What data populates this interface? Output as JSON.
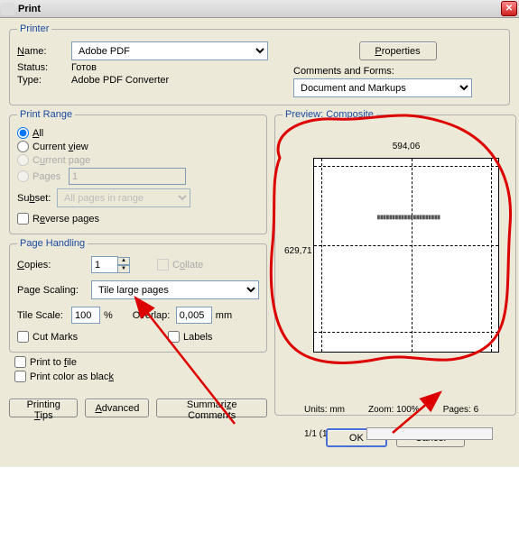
{
  "window": {
    "title": "Print",
    "close": "X"
  },
  "printer": {
    "legend": "Printer",
    "name_label": "Name:",
    "name_value": "Adobe PDF",
    "properties_btn": "Properties",
    "status_label": "Status:",
    "status_value": "Готов",
    "type_label": "Type:",
    "type_value": "Adobe PDF Converter",
    "comments_label": "Comments and Forms:",
    "comments_value": "Document and Markups"
  },
  "range": {
    "legend": "Print Range",
    "all": "All",
    "current_view": "Current view",
    "current_page": "Current page",
    "pages": "Pages",
    "pages_value": "1",
    "subset_label": "Subset:",
    "subset_value": "All pages in range",
    "reverse": "Reverse pages"
  },
  "preview": {
    "legend": "Preview: Composite",
    "width": "594,06",
    "height": "629,71",
    "units": "Units: mm",
    "zoom": "Zoom: 100%",
    "pages": "Pages: 6",
    "counter": "1/1 (1)"
  },
  "handling": {
    "legend": "Page Handling",
    "copies_label": "Copies:",
    "copies_value": "1",
    "collate": "Collate",
    "scaling_label": "Page Scaling:",
    "scaling_value": "Tile large pages",
    "tilescale_label": "Tile Scale:",
    "tilescale_value": "100",
    "tilescale_pct": "%",
    "overlap_label": "Overlap:",
    "overlap_value": "0,005",
    "overlap_unit": "mm",
    "cutmarks": "Cut Marks",
    "labels": "Labels"
  },
  "bottom": {
    "print_to_file": "Print to file",
    "print_as_black": "Print color as black"
  },
  "buttons": {
    "tips": "Printing Tips",
    "advanced": "Advanced",
    "summarize": "Summarize Comments",
    "ok": "OK",
    "cancel": "Cancel"
  }
}
